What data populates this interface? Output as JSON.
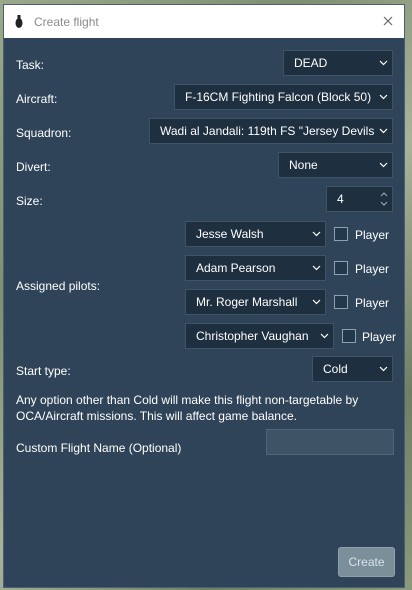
{
  "window": {
    "title": "Create flight",
    "close_icon": "close-icon",
    "app_icon": "bomb-icon"
  },
  "labels": {
    "task": "Task:",
    "aircraft": "Aircraft:",
    "squadron": "Squadron:",
    "divert": "Divert:",
    "size": "Size:",
    "assigned_pilots": "Assigned pilots:",
    "start_type": "Start type:",
    "custom_name": "Custom Flight Name (Optional)"
  },
  "fields": {
    "task": "DEAD",
    "aircraft": "F-16CM Fighting Falcon (Block 50)",
    "squadron": "Wadi al Jandali: 119th FS \"Jersey Devils\"",
    "divert": "None",
    "size": "4",
    "start_type": "Cold",
    "custom_name": ""
  },
  "pilots": [
    {
      "name": "Jesse Walsh",
      "player_label": "Player",
      "player_checked": false
    },
    {
      "name": "Adam Pearson",
      "player_label": "Player",
      "player_checked": false
    },
    {
      "name": "Mr. Roger Marshall",
      "player_label": "Player",
      "player_checked": false
    },
    {
      "name": "Christopher Vaughan",
      "player_label": "Player",
      "player_checked": false
    }
  ],
  "note": "Any option other than Cold will make this flight non-targetable by OCA/Aircraft missions. This will affect game balance.",
  "buttons": {
    "create": "Create"
  },
  "colors": {
    "dialog_bg": "#2f4458",
    "field_bg": "#1e2f40",
    "button_disabled": "#7b8f9a"
  }
}
